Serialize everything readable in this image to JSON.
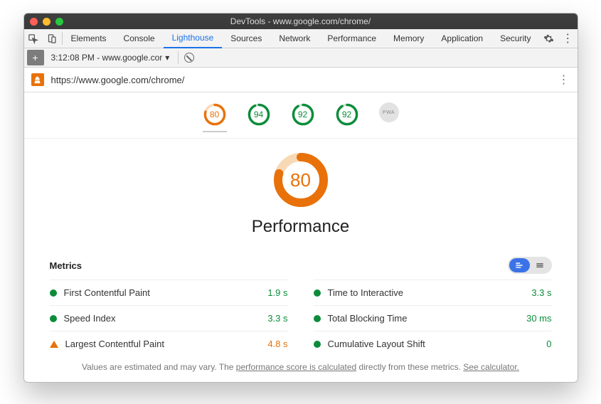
{
  "window": {
    "title": "DevTools - www.google.com/chrome/"
  },
  "tabs": {
    "items": [
      "Elements",
      "Console",
      "Lighthouse",
      "Sources",
      "Network",
      "Performance",
      "Memory",
      "Application",
      "Security"
    ],
    "active_index": 2
  },
  "subbar": {
    "dropdown": "3:12:08 PM - www.google.cor"
  },
  "urlbar": {
    "url": "https://www.google.com/chrome/"
  },
  "scores": {
    "items": [
      {
        "value": 80,
        "color": "#e8710a",
        "key": "performance"
      },
      {
        "value": 94,
        "color": "#0c8c3a",
        "key": "accessibility"
      },
      {
        "value": 92,
        "color": "#0c8c3a",
        "key": "best-practices"
      },
      {
        "value": 92,
        "color": "#0c8c3a",
        "key": "seo"
      }
    ],
    "pwa_label": "PWA",
    "selected_index": 0
  },
  "main_gauge": {
    "value": 80,
    "color": "#e8710a",
    "title": "Performance"
  },
  "metrics": {
    "heading": "Metrics",
    "left": [
      {
        "label": "First Contentful Paint",
        "value": "1.9 s",
        "status": "green"
      },
      {
        "label": "Speed Index",
        "value": "3.3 s",
        "status": "green"
      },
      {
        "label": "Largest Contentful Paint",
        "value": "4.8 s",
        "status": "orange"
      }
    ],
    "right": [
      {
        "label": "Time to Interactive",
        "value": "3.3 s",
        "status": "green"
      },
      {
        "label": "Total Blocking Time",
        "value": "30 ms",
        "status": "green"
      },
      {
        "label": "Cumulative Layout Shift",
        "value": "0",
        "status": "green"
      }
    ]
  },
  "footnote": {
    "prefix": "Values are estimated and may vary. The ",
    "link1": "performance score is calculated",
    "mid": " directly from these metrics. ",
    "link2": "See calculator."
  }
}
